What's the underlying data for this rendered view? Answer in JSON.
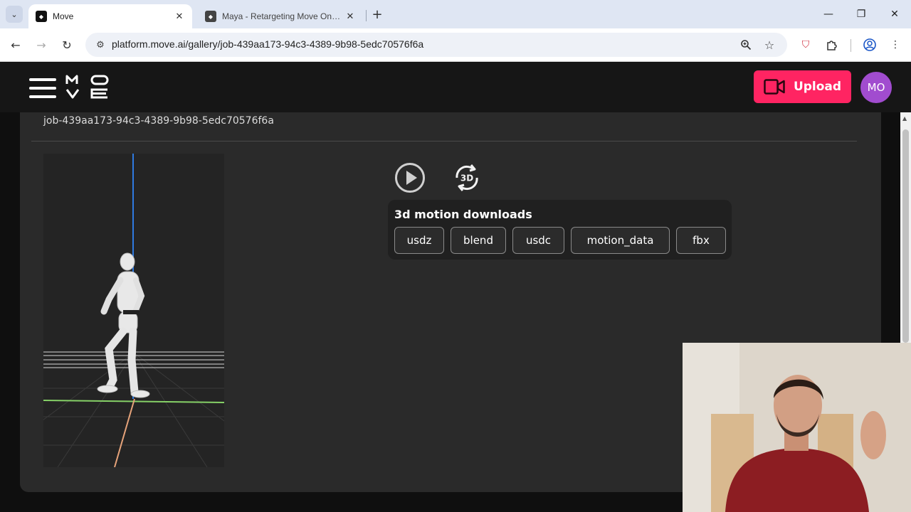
{
  "browser": {
    "tabs": [
      {
        "title": "Move",
        "active": true
      },
      {
        "title": "Maya - Retargeting Move One Animations to M",
        "active": false
      }
    ],
    "url": "platform.move.ai/gallery/job-439aa173-94c3-4389-9b98-5edc70576f6a"
  },
  "header": {
    "upload_label": "Upload",
    "avatar_initials": "MO",
    "brand_color": "#ff2462",
    "avatar_color": "#a14ccf"
  },
  "job": {
    "title": "job-439aa173-94c3-4389-9b98-5edc70576f6a"
  },
  "controls": {
    "rotate_label": "3D"
  },
  "downloads": {
    "title": "3d motion downloads",
    "formats": [
      "usdz",
      "blend",
      "usdc",
      "motion_data",
      "fbx"
    ]
  },
  "icons": {
    "play": "play-circle-icon",
    "rotate": "rotate-3d-icon",
    "upload": "video-camera-icon",
    "menu": "hamburger-icon"
  }
}
